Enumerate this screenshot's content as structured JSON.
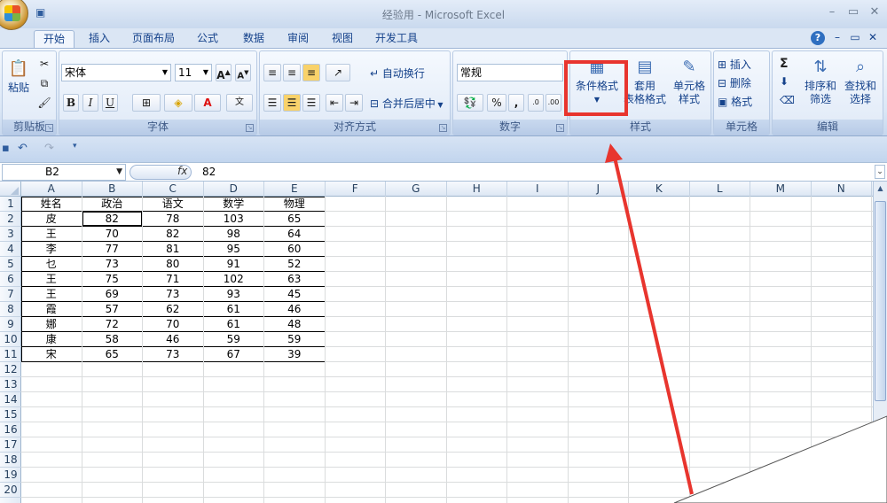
{
  "window": {
    "title": "经验用 - Microsoft Excel"
  },
  "tabs": [
    "开始",
    "插入",
    "页面布局",
    "公式",
    "数据",
    "审阅",
    "视图",
    "开发工具"
  ],
  "ribbon": {
    "clipboard": {
      "paste": "粘贴",
      "label": "剪贴板"
    },
    "font": {
      "name": "宋体",
      "size": "11",
      "bold": "B",
      "italic": "I",
      "underline": "U",
      "color_a": "A",
      "label": "字体",
      "grow": "A",
      "shrink": "A"
    },
    "alignment": {
      "wrap": "自动换行",
      "merge": "合并后居中",
      "label": "对齐方式"
    },
    "number": {
      "format": "常规",
      "percent": "%",
      "comma": ",",
      "label": "数字"
    },
    "styles": {
      "conditional": "条件格式",
      "table_top": "套用",
      "table_bottom": "表格格式",
      "cell_top": "单元格",
      "cell_bottom": "样式",
      "label": "样式"
    },
    "cells": {
      "insert": "插入",
      "delete": "删除",
      "format": "格式",
      "label": "单元格"
    },
    "editing": {
      "sum": "Σ",
      "sort_top": "排序和",
      "sort_bottom": "筛选",
      "find_top": "查找和",
      "find_bottom": "选择",
      "label": "编辑"
    }
  },
  "formula_bar": {
    "name_box": "B2",
    "fx": "fx",
    "value": "82"
  },
  "columns": [
    "A",
    "B",
    "C",
    "D",
    "E",
    "F",
    "G",
    "H",
    "I",
    "J",
    "K",
    "L",
    "M",
    "N"
  ],
  "rows": [
    "1",
    "2",
    "3",
    "4",
    "5",
    "6",
    "7",
    "8",
    "9",
    "10",
    "11",
    "12",
    "13",
    "14",
    "15",
    "16",
    "17",
    "18",
    "19",
    "20"
  ],
  "table": {
    "header": [
      "姓名",
      "政治",
      "语文",
      "数学",
      "物理"
    ],
    "body": [
      [
        "皮",
        "82",
        "78",
        "103",
        "65"
      ],
      [
        "王",
        "70",
        "82",
        "98",
        "64"
      ],
      [
        "李",
        "77",
        "81",
        "95",
        "60"
      ],
      [
        "乜",
        "73",
        "80",
        "91",
        "52"
      ],
      [
        "王",
        "75",
        "71",
        "102",
        "63"
      ],
      [
        "王",
        "69",
        "73",
        "93",
        "45"
      ],
      [
        "霞",
        "57",
        "62",
        "61",
        "46"
      ],
      [
        "娜",
        "72",
        "70",
        "61",
        "48"
      ],
      [
        "康",
        "58",
        "46",
        "59",
        "59"
      ],
      [
        "宋",
        "65",
        "73",
        "67",
        "39"
      ]
    ]
  },
  "selected_cell": "B2",
  "annotation": {
    "color": "#e8352e",
    "target": "条件格式"
  }
}
